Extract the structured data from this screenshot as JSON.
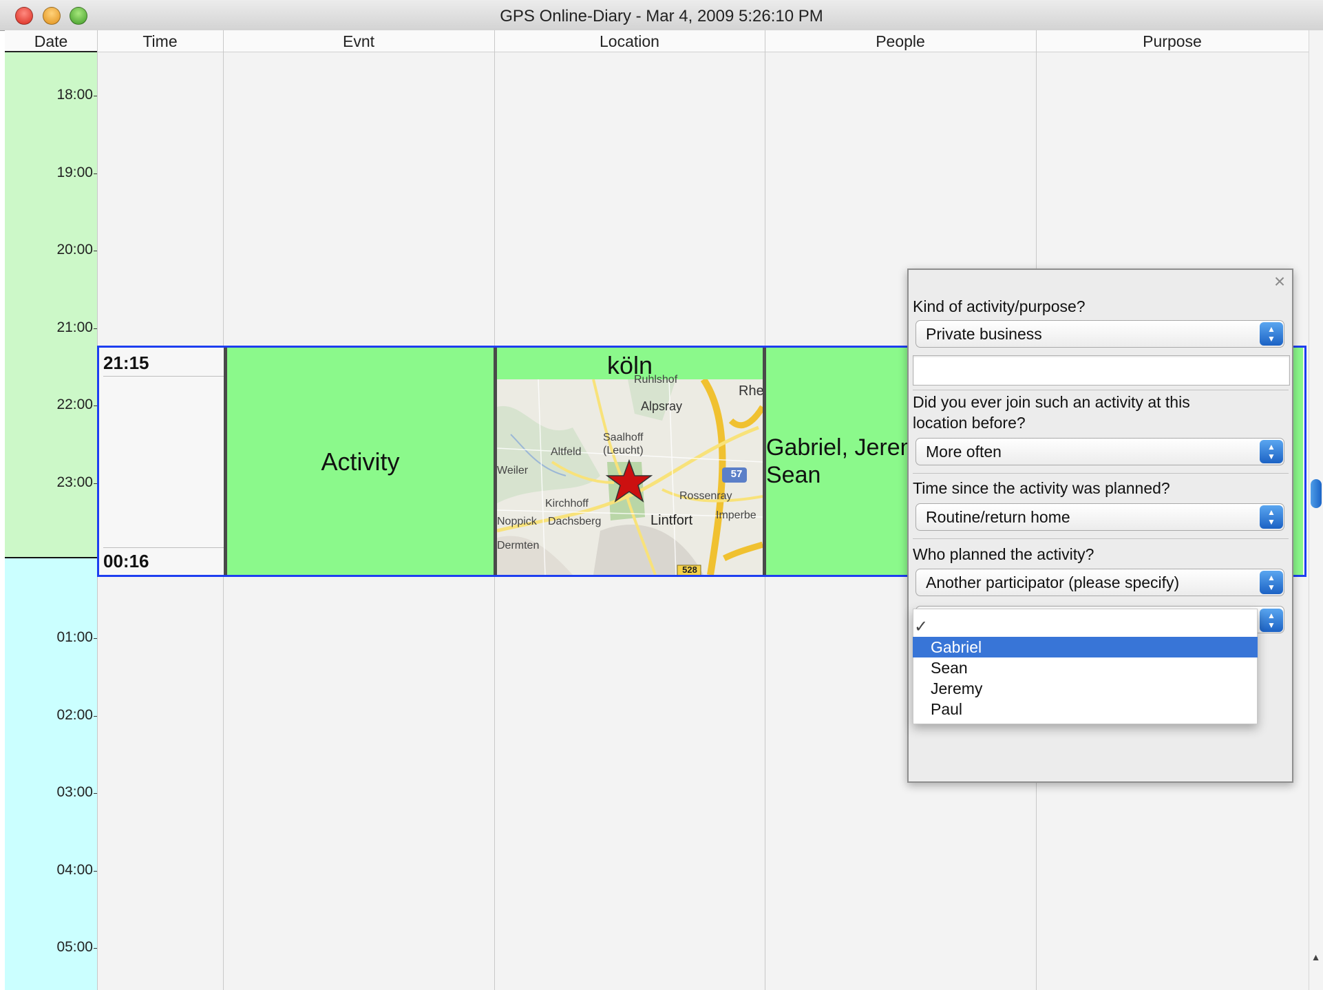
{
  "window": {
    "title": "GPS Online-Diary - Mar 4, 2009 5:26:10 PM",
    "buttons": [
      "close",
      "minimize",
      "zoom"
    ]
  },
  "columns": [
    "Date",
    "Time",
    "Evnt",
    "Location",
    "People",
    "Purpose"
  ],
  "hours_before": [
    "18:00",
    "19:00",
    "20:00",
    "21:00",
    "22:00",
    "23:00"
  ],
  "hours_after": [
    "01:00",
    "02:00",
    "03:00",
    "04:00",
    "05:00"
  ],
  "entry": {
    "start_time": "21:15",
    "end_time": "00:16",
    "event": "Activity",
    "location_name": "köln",
    "people_line1": "Gabriel, Jeremy,",
    "people_line2": "Sean"
  },
  "map": {
    "labels": [
      "Ruhlshof",
      "Alpsray",
      "Rhe",
      "Saalhoff",
      "(Leucht)",
      "Altfeld",
      "Weiler",
      "Rossenray",
      "Kirchhoff",
      "Imperbe",
      "Noppick",
      "Dachsberg",
      "Lintfort",
      "Dermten"
    ],
    "road_badges": [
      "57",
      "528"
    ],
    "marker": "star-icon"
  },
  "dialog": {
    "q1": "Kind of activity/purpose?",
    "q1_value": "Private business",
    "q1_other": "",
    "q2": "Did you ever join such an activity at this",
    "q2b": "location before?",
    "q2_value": "More often",
    "q3": "Time since the activity was planned?",
    "q3_value": "Routine/return home",
    "q4": "Who planned the activity?",
    "q4_value": "Another participator (please specify)",
    "q4_specify_value": "",
    "close": "×"
  },
  "dropdown": {
    "options": [
      "Gabriel",
      "Sean",
      "Jeremy",
      "Paul"
    ],
    "selected": "Gabriel"
  },
  "colors": {
    "date_before_midnight": "#ccf8c8",
    "date_after_midnight": "#cbffff",
    "activity_cell": "#8bf98b",
    "row_border": "#1d3ef0",
    "selection": "#3875d7"
  }
}
